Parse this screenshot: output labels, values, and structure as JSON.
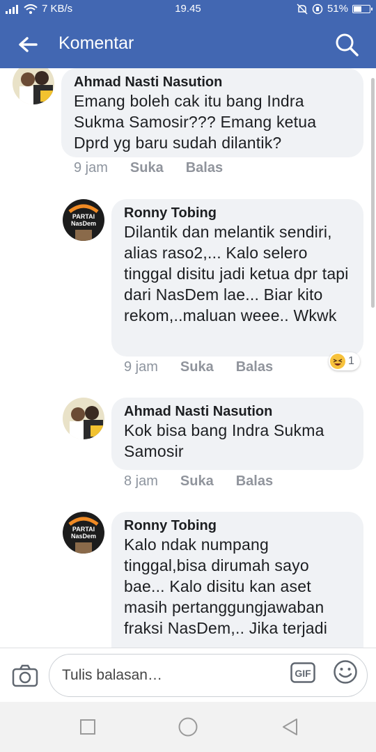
{
  "status_bar": {
    "net_speed": "7 KB/s",
    "time": "19.45",
    "battery": "51%",
    "battery_level": 0.51
  },
  "header": {
    "title": "Komentar"
  },
  "comments": [
    {
      "author": "Ahmad Nasti Nasution",
      "text": "Emang boleh cak itu bang Indra Sukma Samosir??? Emang ketua Dprd yg baru sudah dilantik?",
      "time": "9 jam",
      "like": "Suka",
      "reply": "Balas"
    },
    {
      "author": "Ronny Tobing",
      "text": "Dilantik dan melantik sendiri, alias raso2,... Kalo selero tinggal disitu jadi ketua dpr tapi dari NasDem lae... Biar kito rekom,..maluan weee.. Wkwk",
      "time": "9 jam",
      "like": "Suka",
      "reply": "Balas",
      "reaction_count": "1"
    },
    {
      "author": "Ahmad Nasti Nasution",
      "text_prefix": "Kok bisa bang ",
      "mention": "Indra Sukma Samosir",
      "time": "8 jam",
      "like": "Suka",
      "reply": "Balas"
    },
    {
      "author": "Ronny Tobing",
      "text": "Kalo ndak numpang tinggal,bisa dirumah sayo bae... Kalo disitu kan aset masih pertanggungjawaban fraksi NasDem,.. Jika terjadi"
    }
  ],
  "avatar_text": {
    "partai": "PARTAI",
    "nasdem": "NasDem"
  },
  "reply_bar": {
    "placeholder": "Tulis balasan…",
    "gif": "GIF"
  },
  "colors": {
    "brand": "#4267b2",
    "bubble": "#f0f2f5"
  }
}
